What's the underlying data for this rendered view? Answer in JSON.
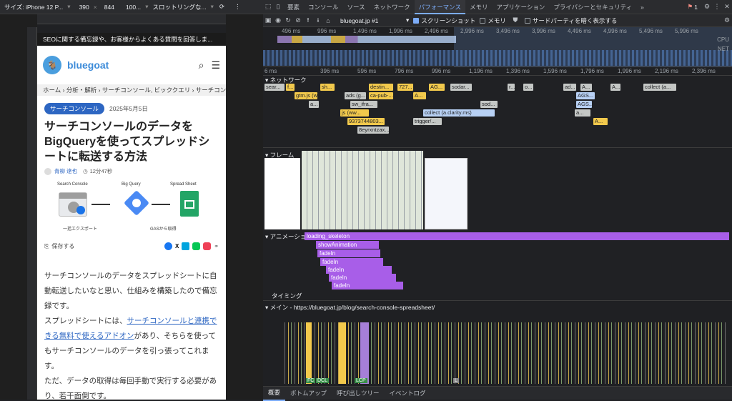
{
  "device_toolbar": {
    "device": "サイズ: iPhone 12 P...",
    "width": "390",
    "height": "844",
    "zoom": "100...",
    "throttle": "スロットリングな..."
  },
  "devtools": {
    "tabs": [
      "要素",
      "コンソール",
      "ソース",
      "ネットワーク",
      "パフォーマンス",
      "メモリ",
      "アプリケーション",
      "プライバシーとセキュリティ"
    ],
    "active_tab": "パフォーマンス",
    "more": "»",
    "issues_count": "1",
    "perf_toolbar": {
      "recording_select": "bluegoat.jp #1",
      "screenshot_label": "スクリーンショット",
      "memory_label": "メモリ",
      "third_party_label": "サードパーティを暗く表示する"
    },
    "overview_ticks": [
      "496 ms",
      "996 ms",
      "1,496 ms",
      "1,996 ms",
      "2,496 ms",
      "2,996 ms",
      "3,496 ms",
      "3,996 ms",
      "4,496 ms",
      "4,996 ms",
      "5,496 ms",
      "5,996 ms"
    ],
    "overview_labels": [
      "CPU",
      "NET"
    ],
    "timeline_ticks": [
      "6 ms",
      "396 ms",
      "596 ms",
      "796 ms",
      "996 ms",
      "1,196 ms",
      "1,396 ms",
      "1,596 ms",
      "1,796 ms",
      "1,996 ms",
      "2,196 ms",
      "2,396 ms"
    ],
    "sections": {
      "network": "ネットワーク",
      "frames": "フレーム",
      "animations": "アニメーション",
      "timings": "タイミング",
      "main": "メイン - https://bluegoat.jp/blog/search-console-spreadsheet/"
    },
    "network_items": [
      {
        "label": "sear...",
        "color": "gray"
      },
      {
        "label": "f...",
        "color": "yel"
      },
      {
        "label": "sh...",
        "color": "yel"
      },
      {
        "label": "destin...",
        "color": "yel"
      },
      {
        "label": "727...",
        "color": "yel"
      },
      {
        "label": "AG...",
        "color": "yel"
      },
      {
        "label": "sodar...",
        "color": "gray"
      },
      {
        "label": "r...",
        "color": "gray"
      },
      {
        "label": "o...",
        "color": "gray"
      },
      {
        "label": "ad...",
        "color": "gray"
      },
      {
        "label": "A...",
        "color": "gray"
      },
      {
        "label": "A...",
        "color": "gray"
      },
      {
        "label": "collect (a...",
        "color": "gray"
      },
      {
        "label": "gtm.js (www....",
        "color": "yel"
      },
      {
        "label": "ads (g...",
        "color": "gray"
      },
      {
        "label": "ca-pub-...",
        "color": "yel"
      },
      {
        "label": "A...",
        "color": "yel"
      },
      {
        "label": "AGS...",
        "color": "blue"
      },
      {
        "label": "a...",
        "color": "gray"
      },
      {
        "label": "sw_ifra...",
        "color": "gray"
      },
      {
        "label": "sod...",
        "color": "gray"
      },
      {
        "label": "AGS...",
        "color": "blue"
      },
      {
        "label": "js (ww...",
        "color": "yel"
      },
      {
        "label": "collect (a.clarity.ms)",
        "color": "blue"
      },
      {
        "label": "a...",
        "color": "gray"
      },
      {
        "label": "9373744803...",
        "color": "yel"
      },
      {
        "label": "trigger/...",
        "color": "gray"
      },
      {
        "label": "A...",
        "color": "yel"
      },
      {
        "label": "8eyrxntzax...",
        "color": "gray"
      }
    ],
    "animations": [
      "loading_skeleton",
      "showAnimation",
      "fadeIn",
      "fadeIn",
      "fadeIn",
      "fadeIn",
      "fadeIn"
    ],
    "markers": [
      "FC",
      "DCL",
      "LCP",
      "L"
    ],
    "bottom_tabs": [
      "概要",
      "ボトムアップ",
      "呼び出しツリー",
      "イベントログ"
    ],
    "active_bottom_tab": "概要"
  },
  "page": {
    "seo_bar": "SEOに関する備忘録や、お客様からよくある質問を回答しま...",
    "logo": "bluegoat",
    "breadcrumb": "ホーム › 分析・解析 › サーチコンソール, ビッククエリ › サーチコン",
    "category": "サーチコンソール",
    "date": "2025年5月5日",
    "title": "サーチコンソールのデータをBigQueryを使ってスプレッドシートに転送する方法",
    "author": "青柳 達也",
    "read_time": "12分47秒",
    "diagram": {
      "labels": [
        "Search Console",
        "Big Query",
        "Spread Sheet"
      ],
      "captions": [
        "一括エクスポート",
        "GASから取得"
      ]
    },
    "save_label": "保存する",
    "share_icons": [
      "facebook-icon",
      "x-icon",
      "hatena-icon",
      "line-icon",
      "pocket-icon",
      "link-icon"
    ],
    "para1": "サーチコンソールのデータをスプレッドシートに自動転送したいなと思い、仕組みを構築したので備忘録です。",
    "para2_a": "スプレッドシートには、",
    "para2_link": "サーチコンソールと連携できる無料で使えるアドオン",
    "para2_b": "があり、そちらを使ってもサーチコンソールのデータを引っ張ってこれます。",
    "para3": "ただ、データの取得は毎回手動で実行する必要があり、若干面倒です。"
  },
  "colors": {
    "accent": "#7cacf8",
    "animation": "#a85ee8",
    "link": "#2d66c2"
  }
}
